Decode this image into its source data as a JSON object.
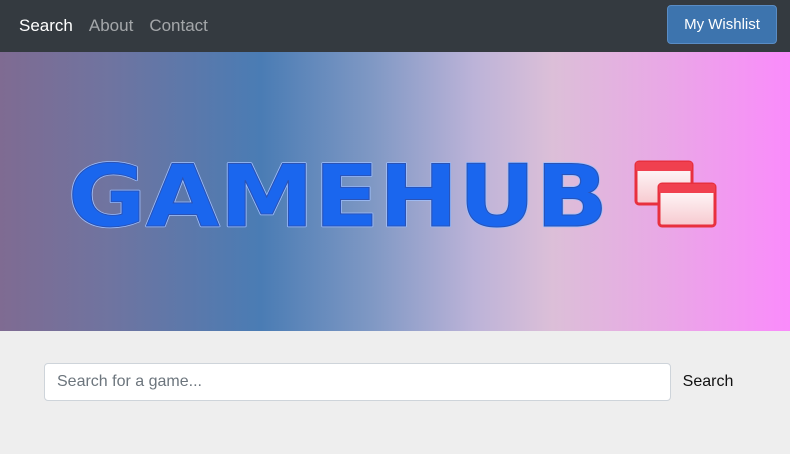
{
  "nav": {
    "links": [
      "Search",
      "About",
      "Contact"
    ],
    "active": "Search",
    "wishlist_label": "My Wishlist"
  },
  "hero": {
    "logo_text": "GAMEHUB",
    "logo_icon": "window-stack-icon"
  },
  "search": {
    "placeholder": "Search for a game...",
    "value": "",
    "button_label": "Search"
  },
  "colors": {
    "navbar": "#343a40",
    "wishlist_button": "#3d74ae",
    "logo_blue": "#1a66ee",
    "logo_windows_red": "#f04050",
    "page_background": "#eeeeee"
  }
}
